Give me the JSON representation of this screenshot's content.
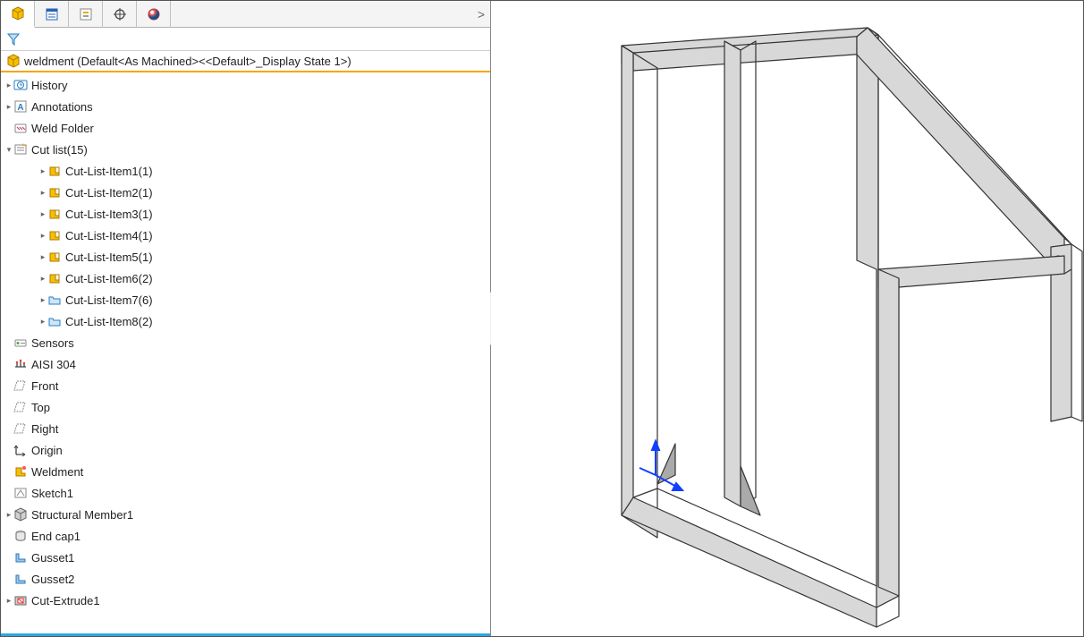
{
  "root": {
    "label": "weldment  (Default<As Machined><<Default>_Display State 1>)"
  },
  "tabs": {
    "overflow_glyph": ">"
  },
  "tree": [
    {
      "arrow": "▸",
      "indent": 1,
      "icon": "history",
      "label": "History"
    },
    {
      "arrow": "▸",
      "indent": 1,
      "icon": "annotations",
      "label": "Annotations"
    },
    {
      "arrow": "",
      "indent": 1,
      "icon": "weld-folder",
      "label": "Weld Folder"
    },
    {
      "arrow": "▾",
      "indent": 1,
      "icon": "cutlist",
      "label": "Cut list(15)"
    },
    {
      "arrow": "▸",
      "indent": 3,
      "icon": "cutitem",
      "label": "Cut-List-Item1(1)"
    },
    {
      "arrow": "▸",
      "indent": 3,
      "icon": "cutitem",
      "label": "Cut-List-Item2(1)"
    },
    {
      "arrow": "▸",
      "indent": 3,
      "icon": "cutitem",
      "label": "Cut-List-Item3(1)"
    },
    {
      "arrow": "▸",
      "indent": 3,
      "icon": "cutitem",
      "label": "Cut-List-Item4(1)"
    },
    {
      "arrow": "▸",
      "indent": 3,
      "icon": "cutitem",
      "label": "Cut-List-Item5(1)"
    },
    {
      "arrow": "▸",
      "indent": 3,
      "icon": "cutitem",
      "label": "Cut-List-Item6(2)"
    },
    {
      "arrow": "▸",
      "indent": 3,
      "icon": "folder",
      "label": "Cut-List-Item7(6)"
    },
    {
      "arrow": "▸",
      "indent": 3,
      "icon": "folder",
      "label": "Cut-List-Item8(2)"
    },
    {
      "arrow": "",
      "indent": 1,
      "icon": "sensors",
      "label": "Sensors"
    },
    {
      "arrow": "",
      "indent": 1,
      "icon": "material",
      "label": "AISI 304"
    },
    {
      "arrow": "",
      "indent": 1,
      "icon": "plane",
      "label": "Front"
    },
    {
      "arrow": "",
      "indent": 1,
      "icon": "plane",
      "label": "Top"
    },
    {
      "arrow": "",
      "indent": 1,
      "icon": "plane",
      "label": "Right"
    },
    {
      "arrow": "",
      "indent": 1,
      "icon": "origin",
      "label": "Origin"
    },
    {
      "arrow": "",
      "indent": 1,
      "icon": "weldment",
      "label": "Weldment"
    },
    {
      "arrow": "",
      "indent": 1,
      "icon": "sketch",
      "label": "Sketch1"
    },
    {
      "arrow": "▸",
      "indent": 1,
      "icon": "structural",
      "label": "Structural Member1"
    },
    {
      "arrow": "",
      "indent": 1,
      "icon": "endcap",
      "label": "End cap1"
    },
    {
      "arrow": "",
      "indent": 1,
      "icon": "gusset",
      "label": "Gusset1"
    },
    {
      "arrow": "",
      "indent": 1,
      "icon": "gusset",
      "label": "Gusset2"
    },
    {
      "arrow": "▸",
      "indent": 1,
      "icon": "cutextrude",
      "label": "Cut-Extrude1"
    }
  ],
  "icons": {
    "part": "part-icon",
    "properties": "properties-icon",
    "config": "config-icon",
    "target": "target-icon",
    "appearance": "appearance-icon",
    "filter": "filter-icon"
  }
}
